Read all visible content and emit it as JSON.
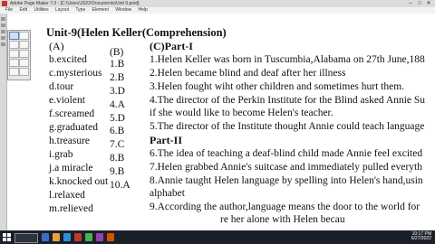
{
  "window": {
    "title": "Adobe Page Maker 7.0 - [C:\\Users\\2022\\Documents\\Unit 9.pmd]"
  },
  "menu": [
    "File",
    "Edit",
    "Utilities",
    "Layout",
    "Type",
    "Element",
    "Window",
    "Help"
  ],
  "doc": {
    "title": "Unit-9(Helen  Keller(Comprehension)",
    "col_a_head": "(A)",
    "col_a": [
      "b.excited",
      "c.mysterious",
      "d.tour",
      "e.violent",
      "f.screamed",
      "g.graduated",
      "h.treasure",
      "i.grab",
      "j.a miracle",
      "k.knocked  out",
      "l.relaxed",
      "m.relieved"
    ],
    "col_b_head": "(B)",
    "col_b": [
      "1.B",
      "2.B",
      "3.D",
      "4.A",
      "5.D",
      "6.B",
      "7.C",
      "8.B",
      "9.B",
      "10.A"
    ],
    "part1_head": "(C)Part-I",
    "part1": [
      "1.Helen Keller was born in Tuscumbia,Alabama on 27th June,188",
      "2.Helen became blind and deaf after her illness",
      "3.Helen fought wiht other children and sometimes hurt them.",
      "4.The director of the Perkin Institute for the Blind asked Annie Su",
      "if she would like to become Helen's teacher.",
      "5.The director of the Institute thought Annie could teach language"
    ],
    "part2_head": "Part-II",
    "part2": [
      "6.The idea of teaching a deaf-blind child made Annie feel excited",
      "7.Helen grabbed Annie's suitcase and immediately pulled everyth",
      "8.Annie taught Helen language by spelling into Helen's hand,usin",
      "alphabet",
      "9.According the author,language means the door to the world for",
      "re her alone with Helen becau"
    ]
  },
  "taskbar": {
    "time": "10:17 PM",
    "date": "6/27/2022"
  },
  "colors": {
    "taskbar": "#1b1f2a",
    "titlebar": "#dcdcdc",
    "toolbar": "#d8d8d8"
  }
}
